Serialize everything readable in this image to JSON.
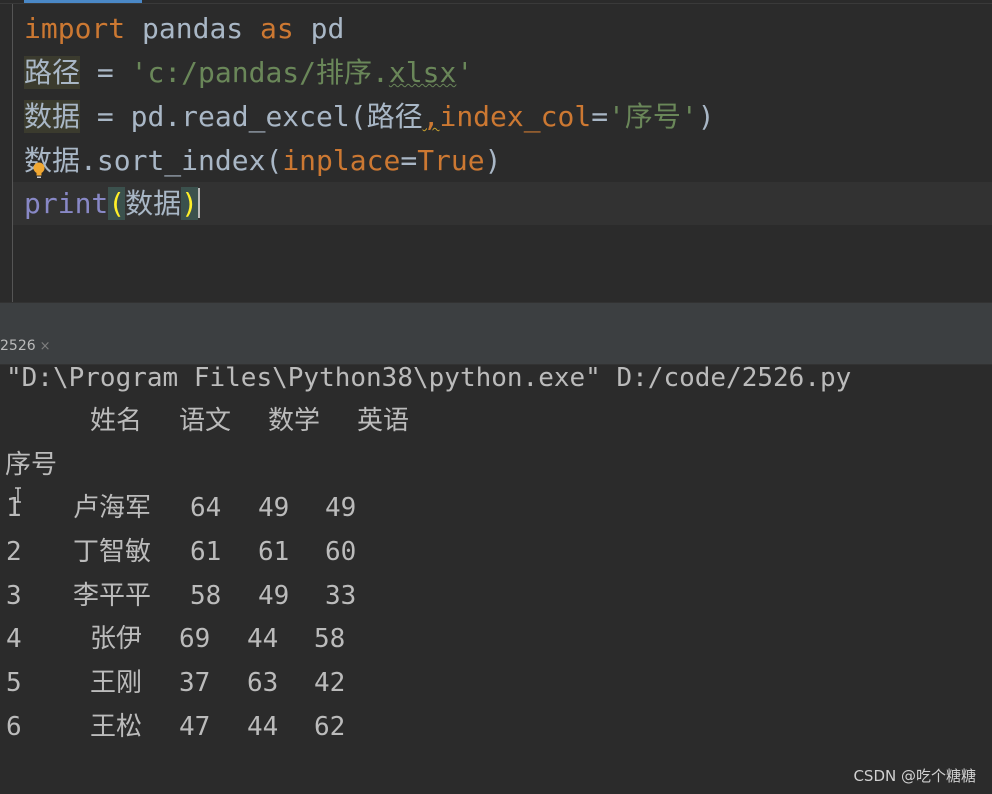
{
  "editor": {
    "lines": [
      {
        "kw_import": "import",
        "module": " pandas ",
        "kw_as": "as",
        "alias": " pd"
      },
      {
        "var": "路径",
        "op": " = ",
        "str_open": "'c:/pandas/排序.",
        "str_ext": "xlsx",
        "str_close": "'"
      },
      {
        "var": "数据",
        "op": " = pd.read_excel(",
        "arg": "路径",
        "comma": ",",
        "param": "index_col",
        "eq": "=",
        "str": "'序号'",
        "close": ")"
      },
      {
        "obj": "数据",
        "method": ".sort_index(",
        "param": "inplace",
        "eq": "=",
        "val": "True",
        "close": ")"
      },
      {
        "func": "print",
        "open": "(",
        "arg": "数据",
        "close": ")"
      }
    ]
  },
  "run_panel": {
    "tab_label": "2526",
    "tab_close": "×"
  },
  "console": {
    "command": "\"D:\\Program Files\\Python38\\python.exe\" D:/code/2526.py",
    "columns": [
      "姓名",
      "语文",
      "数学",
      "英语"
    ],
    "index_name": "序号",
    "rows": [
      {
        "idx": "1",
        "name": "卢海军",
        "c1": "64",
        "c2": "49",
        "c3": "49"
      },
      {
        "idx": "2",
        "name": "丁智敏",
        "c1": "61",
        "c2": "61",
        "c3": "60"
      },
      {
        "idx": "3",
        "name": "李平平",
        "c1": "58",
        "c2": "49",
        "c3": "33"
      },
      {
        "idx": "4",
        "name": "张伊",
        "c1": "69",
        "c2": "44",
        "c3": "58"
      },
      {
        "idx": "5",
        "name": "王刚",
        "c1": "37",
        "c2": "63",
        "c3": "42"
      },
      {
        "idx": "6",
        "name": "王松",
        "c1": "47",
        "c2": "44",
        "c3": "62"
      }
    ]
  },
  "watermark": "CSDN @吃个糖糖",
  "colors": {
    "keyword": "#cc7832",
    "string": "#6a8759",
    "text": "#a9b7c6",
    "builtin": "#8888c6",
    "background": "#2b2b2b"
  }
}
